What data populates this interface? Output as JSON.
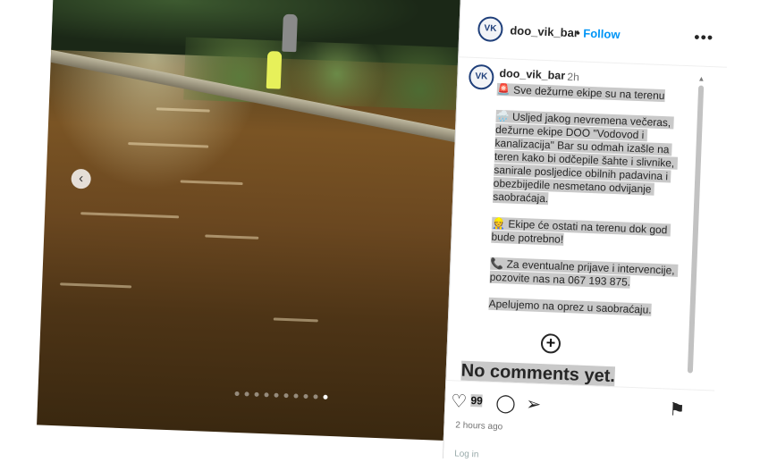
{
  "post": {
    "username": "doo_vik_bar",
    "separator": "•",
    "follow_label": "Follow",
    "more_icon": "more-horizontal-icon",
    "avatar_initials": "VK",
    "time_short": "2h",
    "time_long": "2 hours ago",
    "likes": "99"
  },
  "caption": {
    "line1": "🚨 Sve dežurne ekipe su na terenu",
    "line2": "🌧️ Usljed jakog nevremena večeras, dežurne ekipe DOO \"Vodovod i kanalizacija\" Bar su odmah izašle na teren kako bi odčepile šahte i slivnike, sanirale posljedice obilnih padavina i obezbijedile nesmetano odvijanje saobraćaja.",
    "line3": "👷 Ekipe će ostati na terenu dok god bude potrebno!",
    "line4": "📞 Za eventualne prijave i intervencije, pozovite nas na 067 193 875.",
    "line5": "Apelujemo na oprez u saobraćaju."
  },
  "comments": {
    "empty_text": "No comments yet."
  },
  "footer": {
    "login_hint": "Log in"
  },
  "carousel": {
    "total": 10,
    "active_index": 9
  },
  "colors": {
    "accent": "#0095f6",
    "highlight": "#c9c9c9"
  }
}
